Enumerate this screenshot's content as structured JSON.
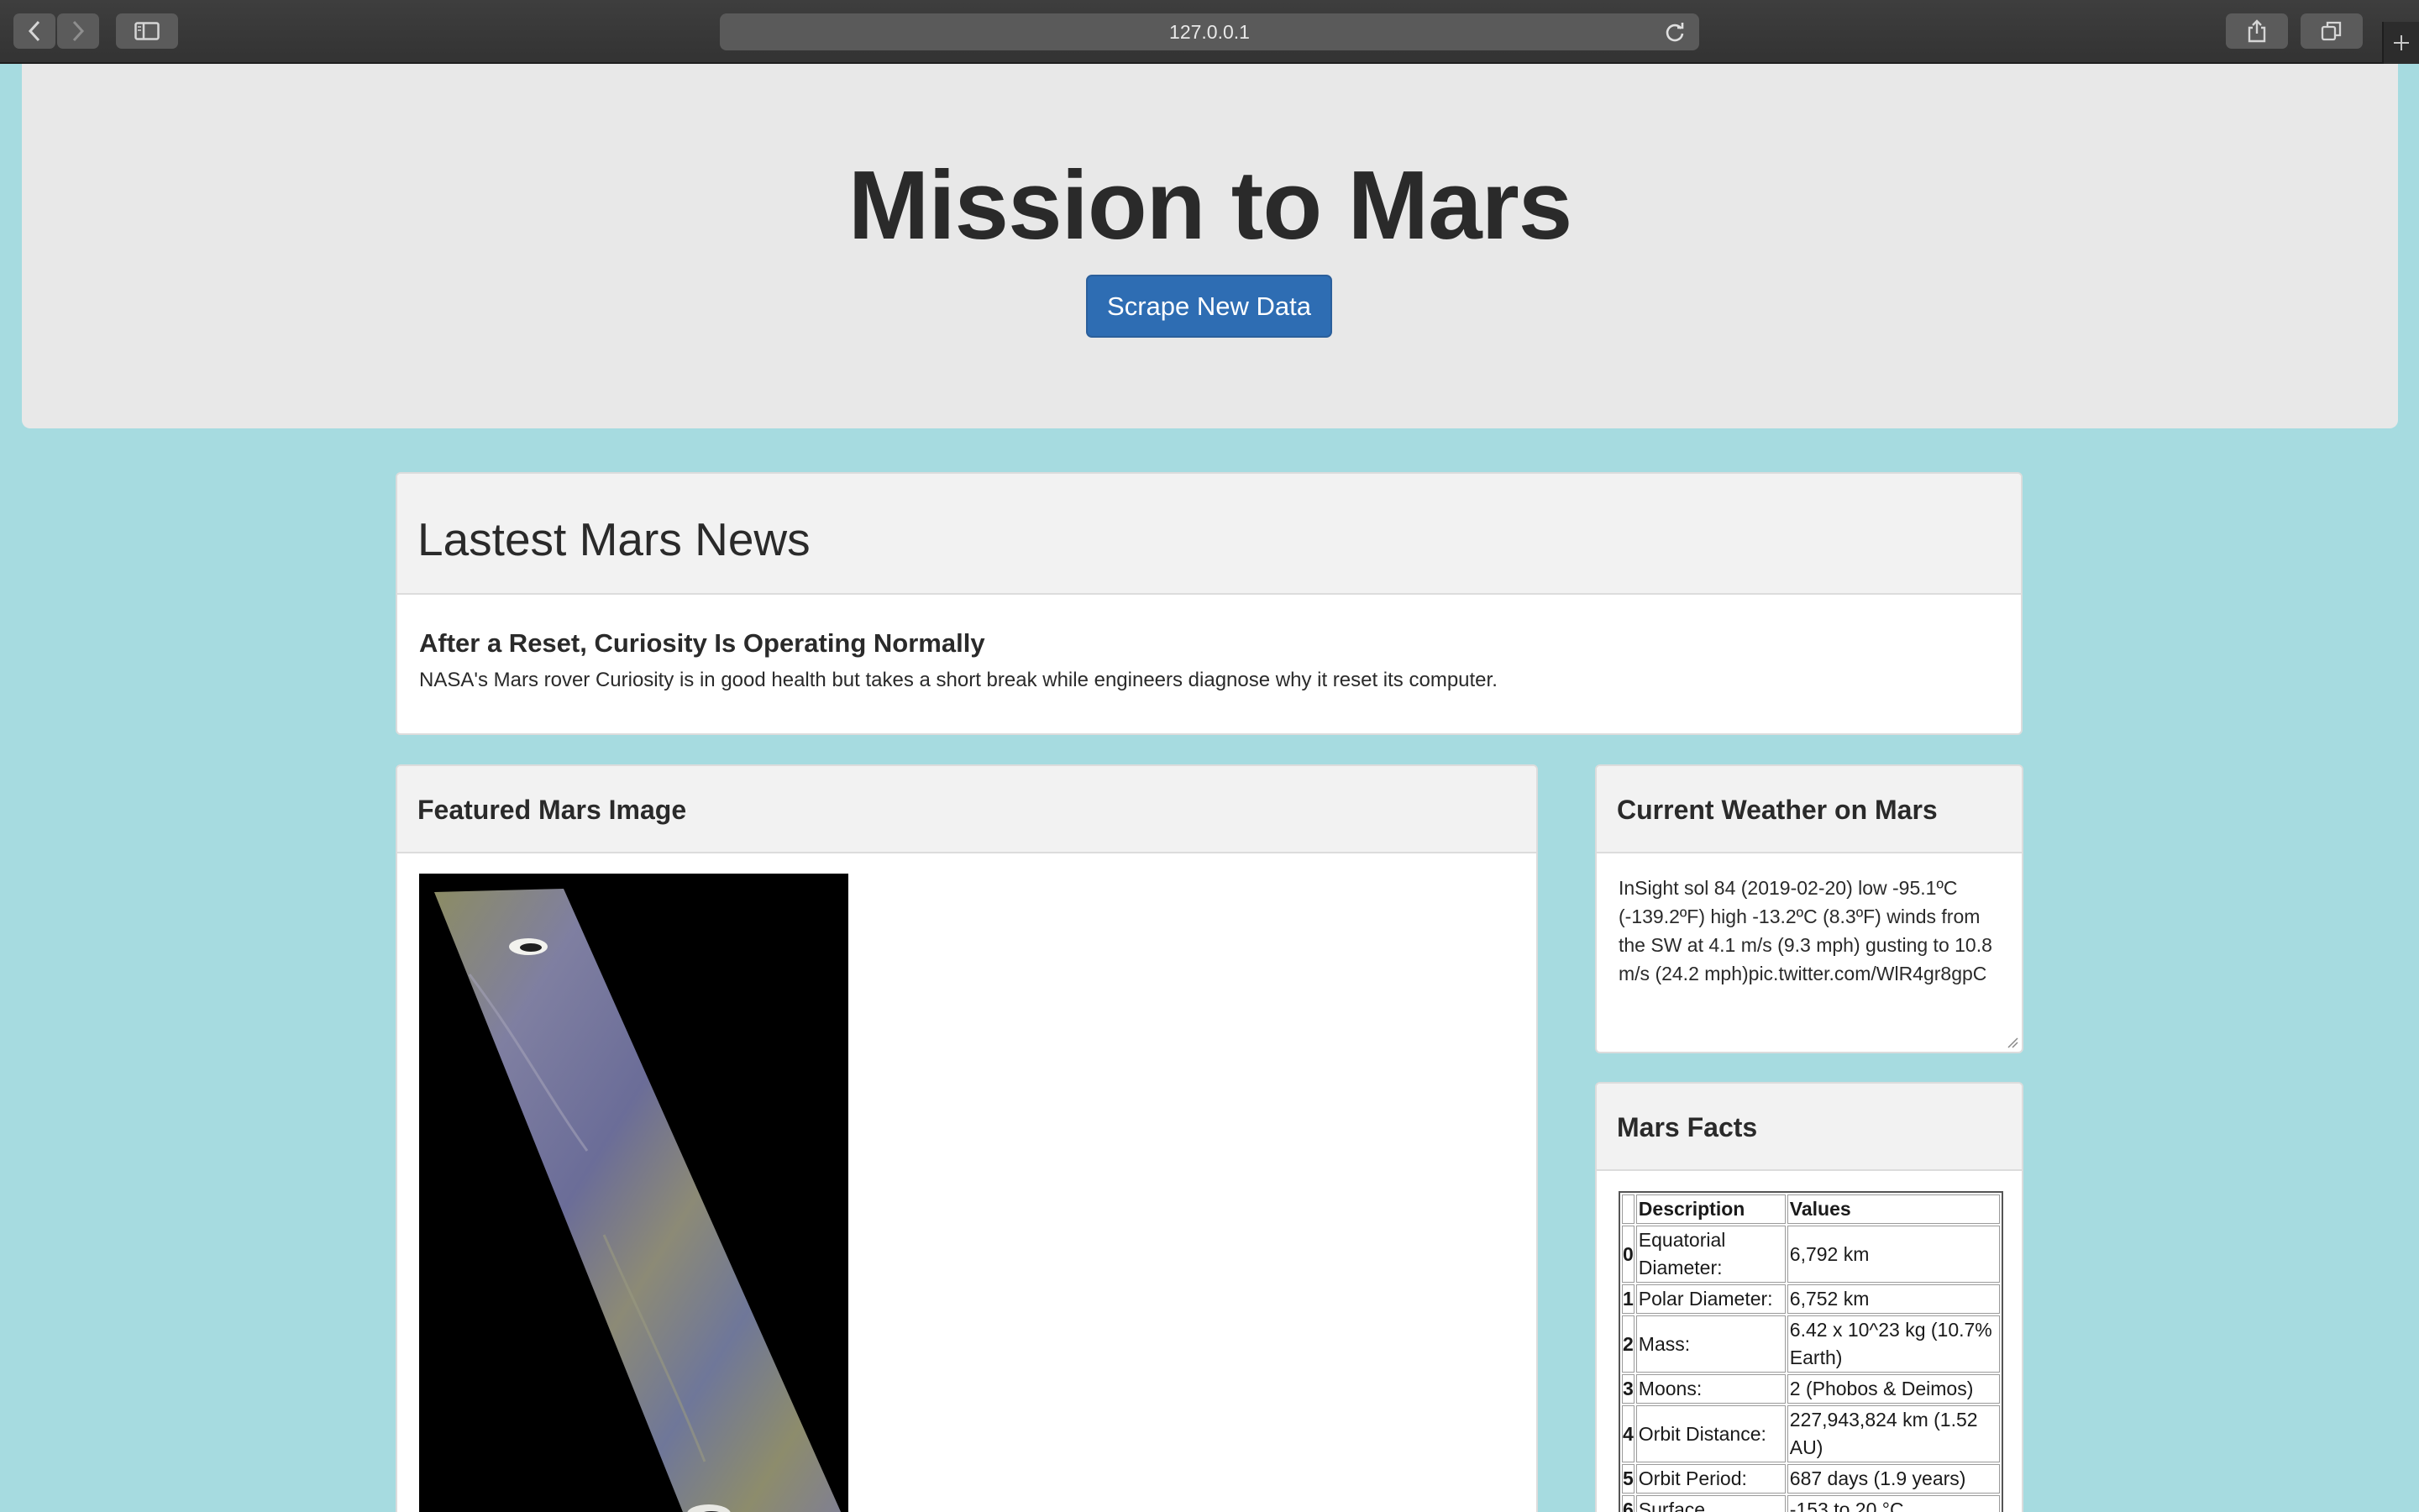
{
  "browser": {
    "url": "127.0.0.1",
    "icons": [
      "back-icon",
      "forward-icon",
      "sidebar-icon",
      "reload-icon",
      "share-icon",
      "tabs-icon",
      "plus-icon"
    ]
  },
  "header": {
    "title": "Mission to Mars",
    "scrape_button": "Scrape New Data",
    "button_color": "#2e6db3"
  },
  "news": {
    "heading": "Lastest Mars News",
    "title": "After a Reset, Curiosity Is Operating Normally",
    "paragraph": "NASA's Mars rover Curiosity is in good health but takes a short break while engineers diagnose why it reset its computer."
  },
  "featured": {
    "heading": "Featured Mars Image"
  },
  "weather": {
    "heading": "Current Weather on Mars",
    "text": "InSight sol 84 (2019-02-20) low -95.1ºC (-139.2ºF) high -13.2ºC (8.3ºF) winds from the SW at 4.1 m/s (9.3 mph) gusting to 10.8 m/s (24.2 mph)pic.twitter.com/WlR4gr8gpC"
  },
  "facts": {
    "heading": "Mars Facts",
    "columns": [
      "Description",
      "Values"
    ],
    "rows": [
      {
        "index": "0",
        "description": "Equatorial Diameter:",
        "value": "6,792 km"
      },
      {
        "index": "1",
        "description": "Polar Diameter:",
        "value": "6,752 km"
      },
      {
        "index": "2",
        "description": "Mass:",
        "value": "6.42 x 10^23 kg (10.7% Earth)"
      },
      {
        "index": "3",
        "description": "Moons:",
        "value": "2 (Phobos & Deimos)"
      },
      {
        "index": "4",
        "description": "Orbit Distance:",
        "value": "227,943,824 km (1.52 AU)"
      },
      {
        "index": "5",
        "description": "Orbit Period:",
        "value": "687 days (1.9 years)"
      },
      {
        "index": "6",
        "description": "Surface",
        "value": "-153 to 20 °C"
      }
    ]
  },
  "colors": {
    "page_background": "#a6dbe0",
    "jumbotron": "#e8e8e8",
    "panel_header": "#f2f2f2"
  }
}
